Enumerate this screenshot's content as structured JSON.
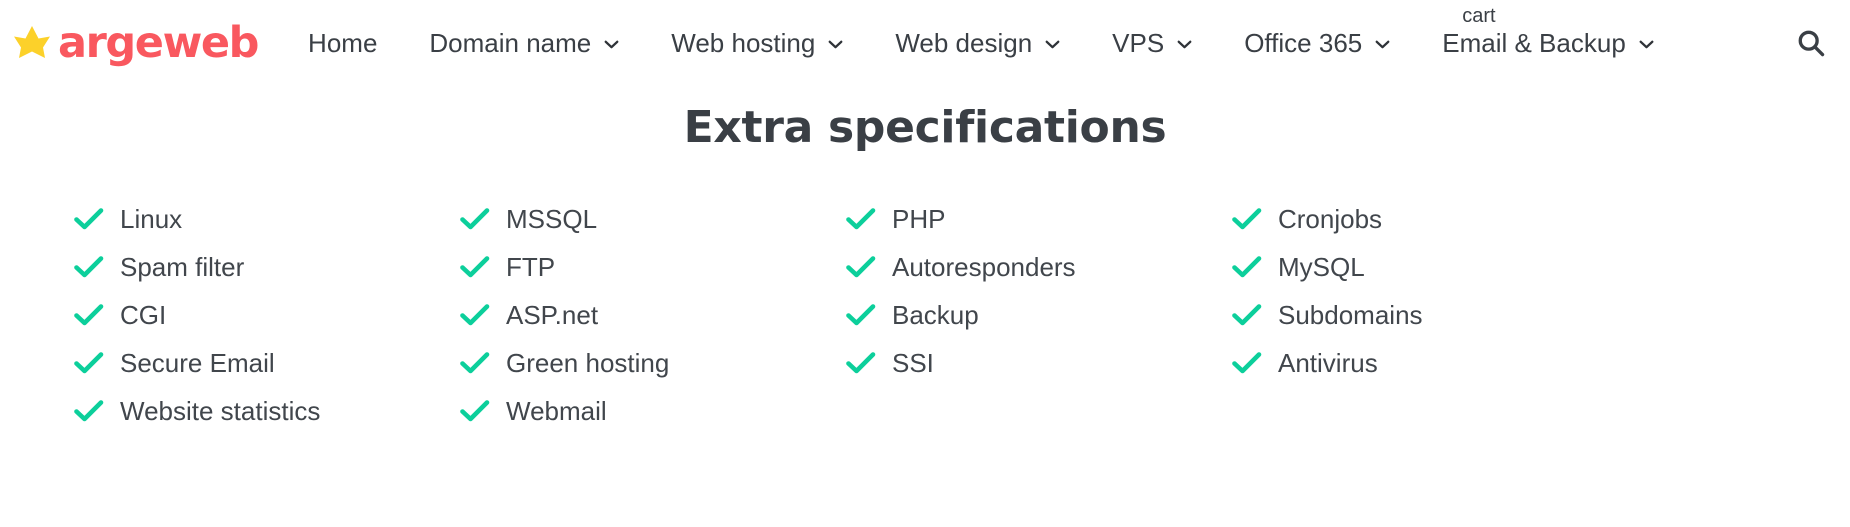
{
  "header": {
    "logo": {
      "icon": "star-icon",
      "word": "argeweb",
      "star_color": "#fcd12a",
      "word_color": "#f9585f"
    },
    "nav_items": [
      {
        "label": "Home",
        "has_dropdown": false,
        "badge": null
      },
      {
        "label": "Domain name",
        "has_dropdown": true,
        "badge": null
      },
      {
        "label": "Web hosting",
        "has_dropdown": true,
        "badge": null
      },
      {
        "label": "Web design",
        "has_dropdown": true,
        "badge": null
      },
      {
        "label": "VPS",
        "has_dropdown": true,
        "badge": null
      },
      {
        "label": "Office 365",
        "has_dropdown": true,
        "badge": null
      },
      {
        "label": "Email & Backup",
        "has_dropdown": true,
        "badge": "cart"
      }
    ],
    "search": {
      "icon": "search-icon",
      "label": "Search"
    }
  },
  "main": {
    "title": "Extra specifications",
    "check_color": "#0ccf9b",
    "columns": [
      {
        "items": [
          {
            "label": "Linux"
          },
          {
            "label": "Spam filter"
          },
          {
            "label": "CGI"
          },
          {
            "label": "Secure Email"
          },
          {
            "label": "Website statistics"
          }
        ]
      },
      {
        "items": [
          {
            "label": "MSSQL"
          },
          {
            "label": "FTP"
          },
          {
            "label": "ASP.net"
          },
          {
            "label": "Green hosting"
          },
          {
            "label": "Webmail"
          }
        ]
      },
      {
        "items": [
          {
            "label": "PHP"
          },
          {
            "label": "Autoresponders"
          },
          {
            "label": "Backup"
          },
          {
            "label": "SSI"
          }
        ]
      },
      {
        "items": [
          {
            "label": "Cronjobs"
          },
          {
            "label": "MySQL"
          },
          {
            "label": "Subdomains"
          },
          {
            "label": "Antivirus"
          }
        ]
      }
    ]
  }
}
